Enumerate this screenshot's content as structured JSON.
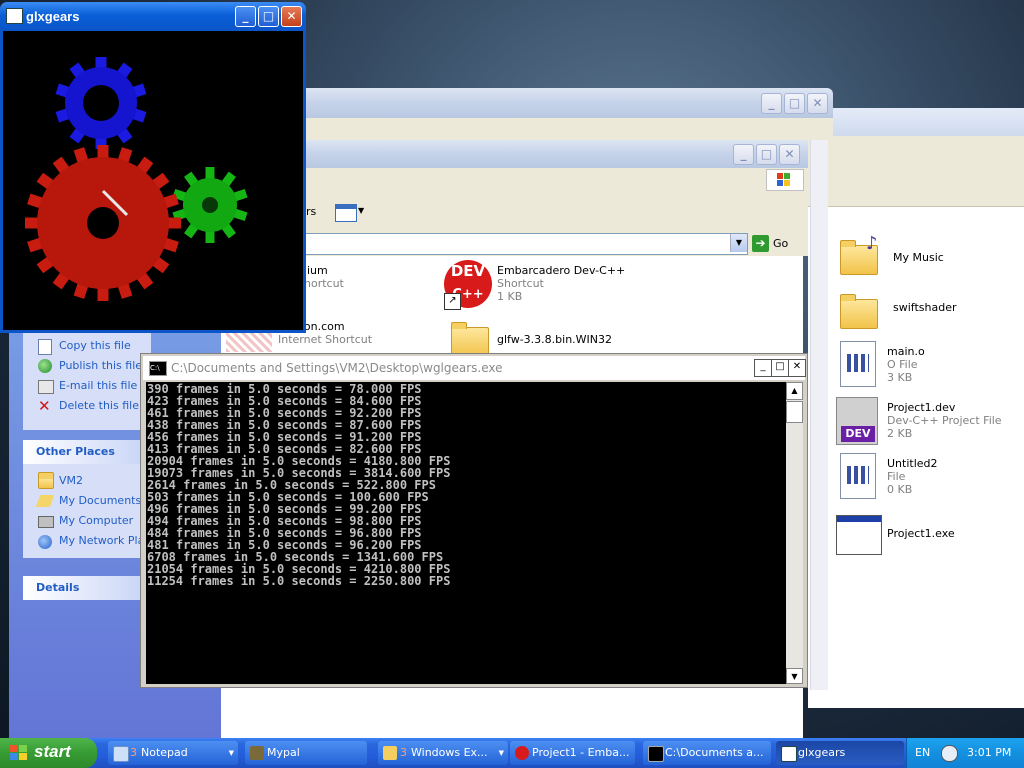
{
  "glxgears": {
    "title": "glxgears"
  },
  "console": {
    "title": "C:\\Documents and Settings\\VM2\\Desktop\\wglgears.exe",
    "lines": [
      "390 frames in 5.0 seconds = 78.000 FPS",
      "423 frames in 5.0 seconds = 84.600 FPS",
      "461 frames in 5.0 seconds = 92.200 FPS",
      "438 frames in 5.0 seconds = 87.600 FPS",
      "456 frames in 5.0 seconds = 91.200 FPS",
      "413 frames in 5.0 seconds = 82.600 FPS",
      "20904 frames in 5.0 seconds = 4180.800 FPS",
      "19073 frames in 5.0 seconds = 3814.600 FPS",
      "2614 frames in 5.0 seconds = 522.800 FPS",
      "503 frames in 5.0 seconds = 100.600 FPS",
      "496 frames in 5.0 seconds = 99.200 FPS",
      "494 frames in 5.0 seconds = 98.800 FPS",
      "484 frames in 5.0 seconds = 96.800 FPS",
      "481 frames in 5.0 seconds = 96.200 FPS",
      "6708 frames in 5.0 seconds = 1341.600 FPS",
      "21054 frames in 5.0 seconds = 4210.800 FPS",
      "11254 frames in 5.0 seconds = 2250.800 FPS"
    ]
  },
  "explorer": {
    "views_label": "rs",
    "go_label": "Go",
    "file_tasks": [
      "Copy this file",
      "Publish this file to",
      "E-mail this file",
      "Delete this file"
    ],
    "other_places_title": "Other Places",
    "other_places": [
      "VM2",
      "My Documents",
      "My Computer",
      "My Network Places"
    ],
    "details_title": "Details",
    "items": {
      "chromium": {
        "name": "ium",
        "type": "hortcut"
      },
      "embarcadero": {
        "name": "Embarcadero Dev-C++",
        "type": "Shortcut",
        "size": "1 KB"
      },
      "wagon": {
        "name": "Wagon.com",
        "type": "Internet Shortcut"
      },
      "glfw": {
        "name": "glfw-3.3.8.bin.WIN32"
      }
    }
  },
  "right_files": [
    {
      "name": "My Music",
      "type": "",
      "size": ""
    },
    {
      "name": "swiftshader",
      "type": "",
      "size": ""
    },
    {
      "name": "main.o",
      "type": "O File",
      "size": "3 KB"
    },
    {
      "name": "Project1.dev",
      "type": "Dev-C++ Project File",
      "size": "2 KB"
    },
    {
      "name": "Untitled2",
      "type": "File",
      "size": "0 KB"
    },
    {
      "name": "Project1.exe",
      "type": "",
      "size": ""
    }
  ],
  "taskbar": {
    "start": "start",
    "items": [
      {
        "label": "Notepad",
        "count": "3"
      },
      {
        "label": "Mypal",
        "count": ""
      },
      {
        "label": "Windows Ex...",
        "count": "3"
      },
      {
        "label": "Project1 - Emba...",
        "count": ""
      },
      {
        "label": "C:\\Documents a...",
        "count": ""
      },
      {
        "label": "glxgears",
        "count": ""
      }
    ],
    "lang": "EN",
    "clock": "3:01 PM"
  }
}
